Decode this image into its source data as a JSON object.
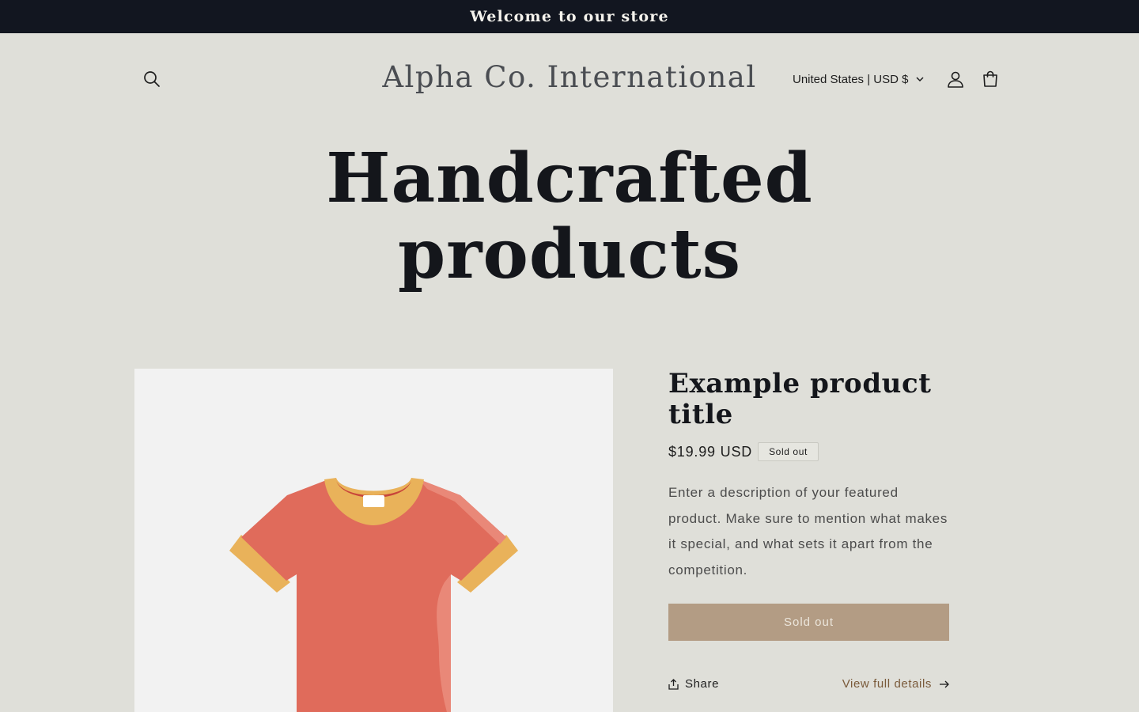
{
  "announcement": {
    "text": "Welcome to our store"
  },
  "header": {
    "logo_text": "Alpha Co. International",
    "currency_label": "United States | USD $",
    "icons": {
      "search": "search-icon",
      "currency_toggle": "chevron-down-icon",
      "account": "account-icon",
      "cart": "cart-icon"
    }
  },
  "hero": {
    "title_line1": "Handcrafted",
    "title_line2": "products"
  },
  "product": {
    "title": "Example product title",
    "price": "$19.99 USD",
    "badge": "Sold out",
    "description": "Enter a description of your featured product. Make sure to mention what makes it special, and what sets it apart from the competition.",
    "button_label": "Sold out",
    "share_label": "Share",
    "details_label": "View full details",
    "image_icon": "t-shirt-illustration"
  },
  "colors": {
    "background": "#dfdfd9",
    "announcement_bg": "#121620",
    "button_disabled": "#b39c84",
    "link": "#7a5a3a",
    "shirt_body": "#e06b5b",
    "shirt_trim": "#e9b25a"
  }
}
